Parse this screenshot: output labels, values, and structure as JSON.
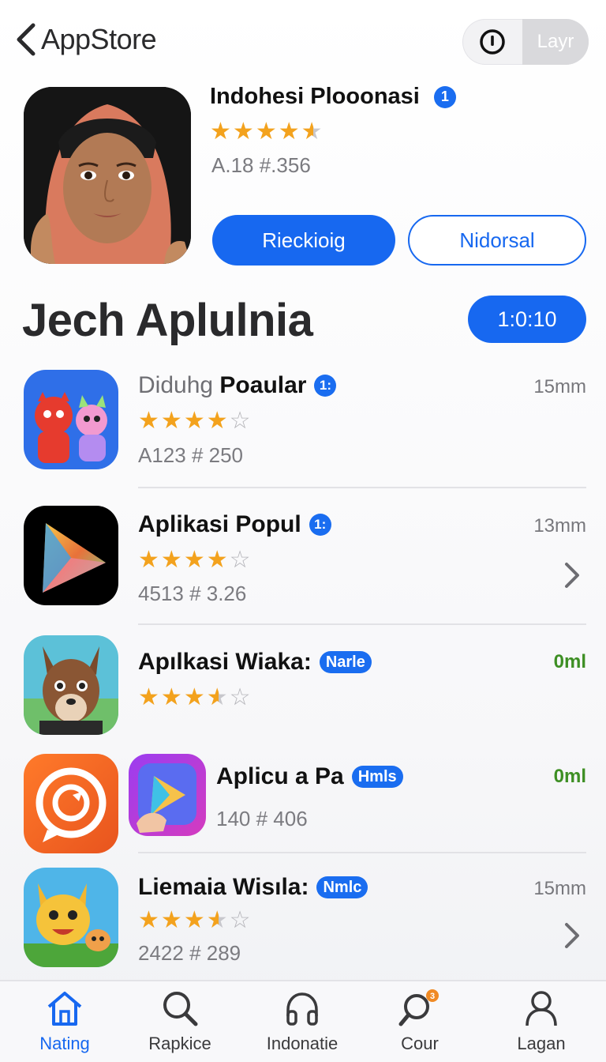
{
  "header": {
    "back_label": "AppStore",
    "toggle_right_label": "Layr"
  },
  "featured": {
    "title": "Indohesi Plooonasi",
    "badge": "1",
    "rating": 4.5,
    "meta": "A.18  #.356",
    "primary_button": "Rieckioig",
    "secondary_button": "Nidorsal"
  },
  "section": {
    "title": "Jech Aplulnia",
    "pill_label": "1:0:10"
  },
  "apps": [
    {
      "title_light": "Diduhg",
      "title": "Poaular",
      "tag": "1:",
      "rating": 4,
      "meta": "A123 # 250",
      "right": "15mm"
    },
    {
      "title": "Aplikasi Popul",
      "tag": "1:",
      "rating": 4,
      "meta": "4513 # 3.26",
      "right": "13mm"
    },
    {
      "title": "Apılkasi Wiaka:",
      "tag": "Narle",
      "rating": 3.5,
      "right": "0ml"
    },
    {
      "title": "Aplicu a Pa",
      "tag": "Hmls",
      "meta": "140 # 406",
      "right": "0ml"
    },
    {
      "title": "Liemaia Wisıla:",
      "tag": "Nmlc",
      "rating": 3.5,
      "meta": "2422 # 289",
      "right": "15mm"
    }
  ],
  "tabs": [
    {
      "label": "Nating",
      "icon": "home-icon",
      "active": true
    },
    {
      "label": "Rapkice",
      "icon": "search-icon"
    },
    {
      "label": "Indonatie",
      "icon": "headphones-icon"
    },
    {
      "label": "Cour",
      "icon": "search-badge-icon",
      "badge": "3"
    },
    {
      "label": "Lagan",
      "icon": "person-icon"
    }
  ],
  "colors": {
    "accent": "#1768f0",
    "star": "#f3a21d",
    "green": "#3e8f24"
  }
}
